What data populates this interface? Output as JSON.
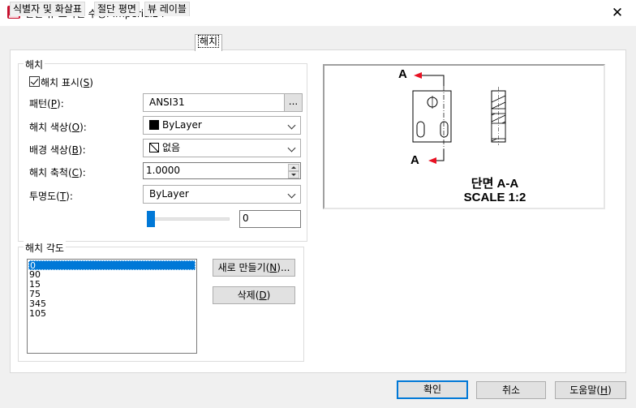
{
  "window": {
    "title": "단면 뷰 스타일 수정: Imperial24",
    "app_icon_letter": "A",
    "close_glyph": "✕"
  },
  "tabs": [
    {
      "label": "식별자 및 화살표"
    },
    {
      "label": "절단 평면"
    },
    {
      "label": "뷰 레이블"
    },
    {
      "label": "해치",
      "active": true
    }
  ],
  "hatch": {
    "group_title": "해치",
    "show_hatch": {
      "label_prefix": "해치 표시(",
      "mnemonic": "S",
      "label_suffix": ")",
      "checked": true
    },
    "pattern": {
      "label_prefix": "패턴(",
      "mnemonic": "P",
      "label_suffix": "):",
      "value": "ANSI31",
      "browse_label": "..."
    },
    "hatch_color": {
      "label_prefix": "해치 색상(",
      "mnemonic": "O",
      "label_suffix": "):",
      "value": "ByLayer",
      "swatch": "#000000"
    },
    "bg_color": {
      "label_prefix": "배경 색상(",
      "mnemonic": "B",
      "label_suffix": "):",
      "value": "없음"
    },
    "hatch_scale": {
      "label_prefix": "해치 축척(",
      "mnemonic": "C",
      "label_suffix": "):",
      "value": "1.0000"
    },
    "transparency": {
      "label_prefix": "투명도(",
      "mnemonic": "T",
      "label_suffix": "):",
      "value": "ByLayer",
      "slider_value": "0"
    }
  },
  "hatch_angle": {
    "group_title": "해치 각도",
    "items": [
      "0",
      "90",
      "15",
      "75",
      "345",
      "105"
    ],
    "selected_index": 0,
    "new_button": {
      "prefix": "새로 만들기(",
      "mnemonic": "N",
      "suffix": ")..."
    },
    "delete_button": {
      "prefix": "삭제(",
      "mnemonic": "D",
      "suffix": ")"
    }
  },
  "preview": {
    "label_a_top": "A",
    "label_a_bottom": "A",
    "section_title": "단면 A-A",
    "scale_text": "SCALE 1:2"
  },
  "footer": {
    "ok": "확인",
    "cancel": "취소",
    "help": {
      "prefix": "도움말(",
      "mnemonic": "H",
      "suffix": ")"
    }
  },
  "colors": {
    "accent": "#0078d7",
    "arrow_red": "#e81123",
    "app_icon_red": "#c8102e"
  }
}
